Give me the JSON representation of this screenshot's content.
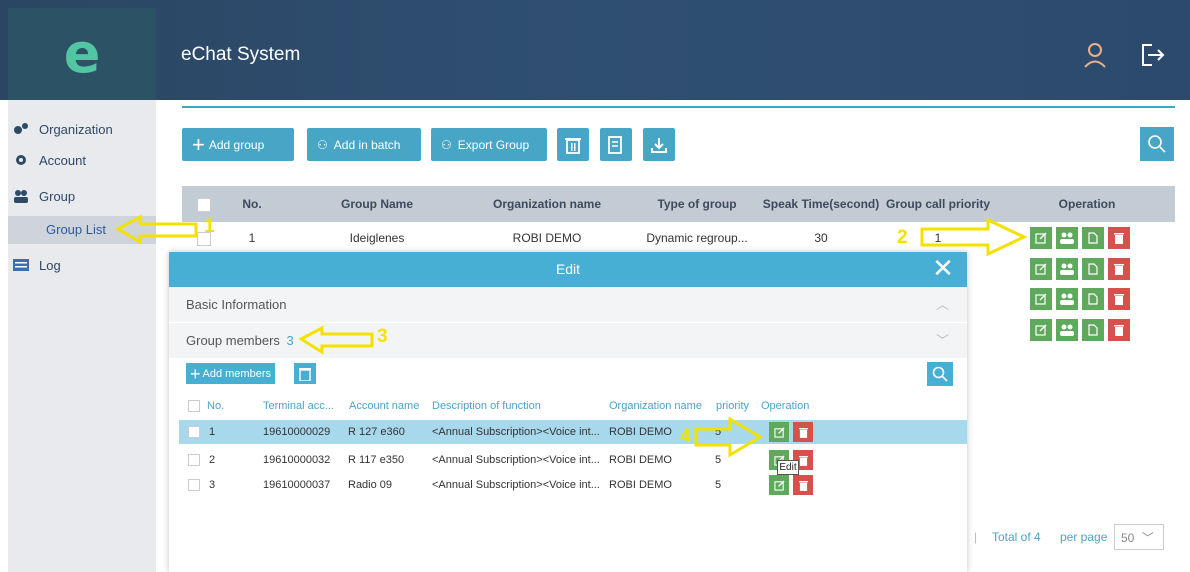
{
  "header": {
    "app_title": "eChat System",
    "logo_letter": "e"
  },
  "sidebar": {
    "items": [
      {
        "label": "Organization",
        "icon": "gears-icon"
      },
      {
        "label": "Account",
        "icon": "gear-icon"
      },
      {
        "label": "Group",
        "icon": "users-icon"
      },
      {
        "label": "Log",
        "icon": "list-icon"
      }
    ],
    "sub_item": "Group List"
  },
  "toolbar": {
    "add_group": "Add group",
    "add_in_batch": "Add in batch",
    "export_group": "Export Group"
  },
  "table": {
    "headers": [
      "No.",
      "Group Name",
      "Organization name",
      "Type of group",
      "Speak Time(second)",
      "Group call priority",
      "Operation"
    ],
    "rows": [
      {
        "no": "1",
        "name": "Ideiglenes",
        "org": "ROBI DEMO",
        "type": "Dynamic regroup...",
        "speak": "30",
        "priority": "1"
      }
    ]
  },
  "pager": {
    "total": "Total of 4",
    "per_page": "per page",
    "size": "50"
  },
  "modal": {
    "title": "Edit",
    "section_basic": "Basic Information",
    "section_members": "Group members",
    "members_count": "3",
    "add_members": "Add members",
    "headers": [
      "No.",
      "Terminal acc...",
      "Account name",
      "Description of function",
      "Organization name",
      "priority",
      "Operation"
    ],
    "rows": [
      {
        "no": "1",
        "terminal": "19610000029",
        "account": "R 127 e360",
        "desc": "<Annual Subscription><Voice int...",
        "org": "ROBI DEMO",
        "priority": "5"
      },
      {
        "no": "2",
        "terminal": "19610000032",
        "account": "R 117 e350",
        "desc": "<Annual Subscription><Voice int...",
        "org": "ROBI DEMO",
        "priority": "5"
      },
      {
        "no": "3",
        "terminal": "19610000037",
        "account": "Radio 09",
        "desc": "<Annual Subscription><Voice int...",
        "org": "ROBI DEMO",
        "priority": "5"
      }
    ],
    "tooltip": "Edit"
  },
  "annotations": [
    "1",
    "2",
    "3",
    "4"
  ],
  "colors": {
    "accent": "#47a6c6",
    "header": "#2f4f72",
    "edit": "#5fa95d",
    "delete": "#d6514c",
    "annotation": "#f3e100"
  }
}
